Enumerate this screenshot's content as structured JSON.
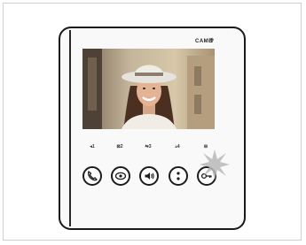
{
  "product": {
    "brand_logo": "CAME",
    "brand_glyph": "✟"
  },
  "screen": {
    "content": "video-feed-visitor-woman-hat"
  },
  "buttons": [
    {
      "label": "◂1",
      "icon": "handset-icon"
    },
    {
      "label": "⊠2",
      "icon": "eye-icon"
    },
    {
      "label": "⇆3",
      "icon": "speaker-icon"
    },
    {
      "label": "▵4",
      "icon": "menu-dots-icon"
    },
    {
      "label": "⊞",
      "icon": "key-icon"
    }
  ],
  "colors": {
    "bezel": "#1a1a1a",
    "screen_bg": "#b6a588",
    "flash": "#b9b9b9"
  }
}
